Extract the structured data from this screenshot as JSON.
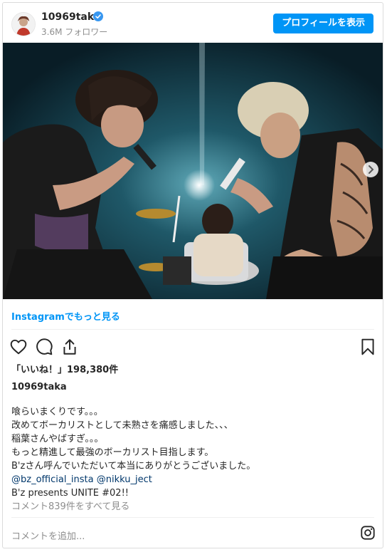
{
  "header": {
    "username": "10969taka",
    "followers": "3.6M フォロワー",
    "profile_button": "プロフィールを表示"
  },
  "post": {
    "more_link": "Instagramでもっと見る",
    "likes_label": "「いいね！」198,380件",
    "caption_user": "10969taka",
    "caption_lines": [
      "喰らいまくりです。。。",
      "改めてボーカリストとして未熟さを痛感しました、、、",
      "稲葉さんやばすぎ。。。",
      "もっと精進して最強のボーカリスト目指します。",
      "B'zさん呼んでいただいて本当にありがとうございました。"
    ],
    "mention_1": "@bz_official_insta",
    "mention_2": "@nikku_ject",
    "caption_tail": "B'z presents UNITE #02!!",
    "comments_link": "コメント839件をすべて見る",
    "comment_placeholder": "コメントを追加..."
  },
  "icons": {
    "verified": "verified-badge-icon",
    "like": "heart-icon",
    "comment": "comment-icon",
    "share": "share-icon",
    "save": "bookmark-icon",
    "next": "chevron-right-icon",
    "instagram": "instagram-icon"
  },
  "colors": {
    "accent": "#0095f6",
    "mention": "#00376b",
    "muted": "#8e8e8e"
  }
}
